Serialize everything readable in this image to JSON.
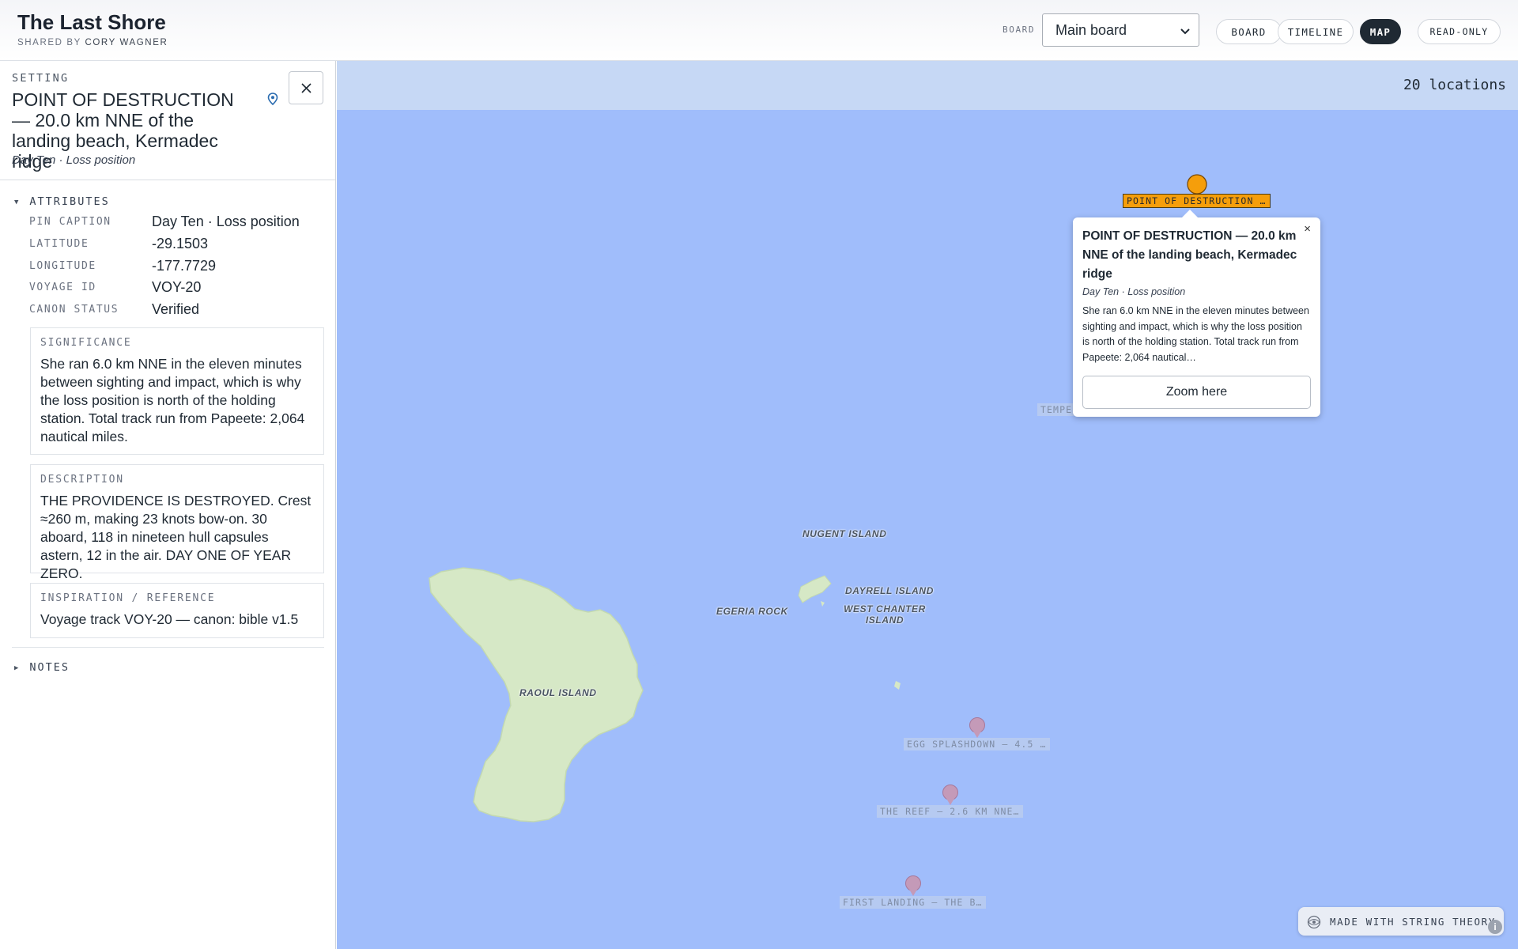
{
  "header": {
    "title": "The Last Shore",
    "shared_prefix": "SHARED BY",
    "shared_by": "CORY WAGNER",
    "board_label": "BOARD",
    "board_selected": "Main board",
    "views": [
      "BOARD",
      "TIMELINE",
      "MAP"
    ],
    "active_view": "MAP",
    "mode_badge": "READ-ONLY"
  },
  "panel": {
    "kicker": "SETTING",
    "title": "POINT OF DESTRUCTION — 20.0 km NNE of the landing beach, Kermadec ridge",
    "caption": "Day Ten · Loss position",
    "attributes_label": "ATTRIBUTES",
    "attributes": [
      {
        "key": "PIN CAPTION",
        "value": "Day Ten · Loss position"
      },
      {
        "key": "LATITUDE",
        "value": "-29.1503"
      },
      {
        "key": "LONGITUDE",
        "value": "-177.7729"
      },
      {
        "key": "VOYAGE ID",
        "value": "VOY-20"
      },
      {
        "key": "CANON STATUS",
        "value": "Verified"
      }
    ],
    "cards": [
      {
        "label": "SIGNIFICANCE",
        "body": "She ran 6.0 km NNE in the eleven minutes between sighting and impact, which is why the loss position is north of the holding station. Total track run from Papeete: 2,064 nautical miles."
      },
      {
        "label": "DESCRIPTION",
        "body": "THE PROVIDENCE IS DESTROYED. Crest ≈260 m, making 23 knots bow-on. 30 aboard, 118 in nineteen hull capsules astern, 12 in the air. DAY ONE OF YEAR ZERO."
      },
      {
        "label": "INSPIRATION / REFERENCE",
        "body": "Voyage track VOY-20 — canon: bible v1.5"
      }
    ],
    "notes_label": "NOTES"
  },
  "map": {
    "location_count": "20 locations",
    "places": {
      "raoul": "RAOUL ISLAND",
      "nugent": "NUGENT ISLAND",
      "egeria": "EGERIA ROCK",
      "dayrell": "DAYRELL ISLAND",
      "west_chanter": "WEST CHANTER ISLAND"
    },
    "pins": [
      {
        "label": "POINT OF DESTRUCTION …",
        "color": "#f59e0b"
      },
      {
        "label": "TEMPE"
      },
      {
        "label": "EGG SPLASHDOWN — 4.5 …"
      },
      {
        "label": "THE REEF — 2.6 KM NNE…"
      },
      {
        "label": "FIRST LANDING — THE B…"
      }
    ],
    "popup": {
      "title": "POINT OF DESTRUCTION — 20.0 km NNE of the landing beach, Kermadec ridge",
      "caption": "Day Ten · Loss position",
      "body": "She ran 6.0 km NNE in the eleven minutes between sighting and impact, which is why the loss position is north of the holding station. Total track run from Papeete: 2,064 nautical…",
      "zoom_label": "Zoom here",
      "close_glyph": "×"
    },
    "attribution": "MADE WITH STRING THEORY",
    "info_glyph": "i"
  },
  "colors": {
    "water": "#a0bdfb",
    "land": "#d6e8c6",
    "pin_active": "#f59e0b",
    "pin_inactive": "#c49ab8"
  }
}
